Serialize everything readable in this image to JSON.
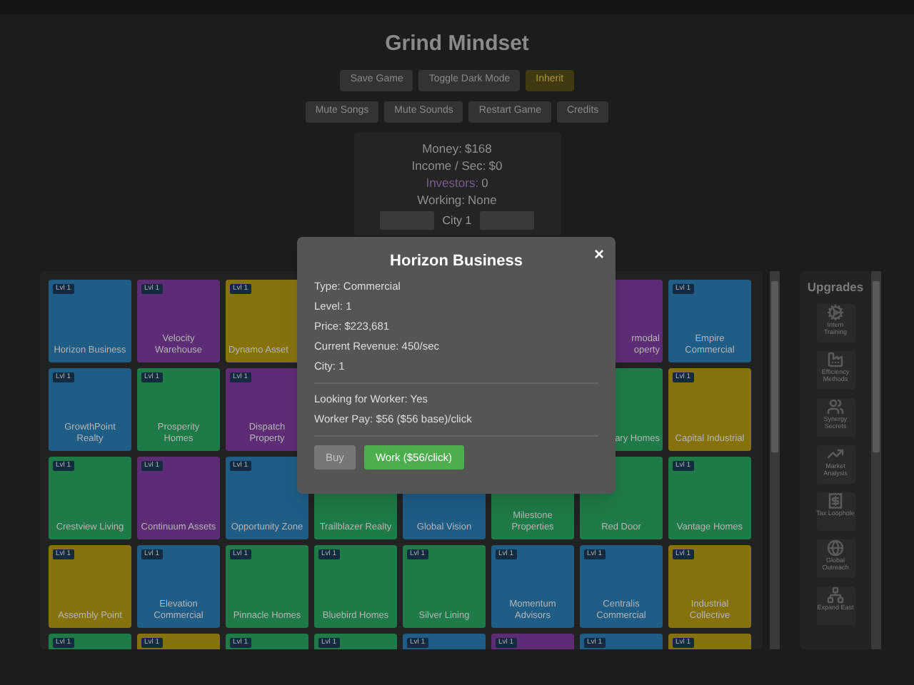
{
  "title": "Grind Mindset",
  "toolbar_rows": [
    [
      {
        "label": "Save Game",
        "kind": "normal"
      },
      {
        "label": "Toggle Dark Mode",
        "kind": "normal"
      },
      {
        "label": "Inherit",
        "kind": "accent"
      }
    ],
    [
      {
        "label": "Mute Songs",
        "kind": "normal"
      },
      {
        "label": "Mute Sounds",
        "kind": "normal"
      },
      {
        "label": "Restart Game",
        "kind": "normal"
      },
      {
        "label": "Credits",
        "kind": "normal"
      }
    ]
  ],
  "stats": [
    {
      "label": "Money:",
      "value": "$168",
      "kind": "plain"
    },
    {
      "label": "Income / Sec:",
      "value": "$0",
      "kind": "plain"
    },
    {
      "label": "Investors:",
      "value": "0",
      "kind": "accent"
    },
    {
      "label": "Working:",
      "value": "None",
      "kind": "plain"
    }
  ],
  "city": {
    "label": "City 1"
  },
  "grid": {
    "rows": [
      [
        {
          "name": "Horizon Business",
          "color": "#1f5c86",
          "badge": "Lvl 1",
          "kind": "whole"
        },
        {
          "name": "Velocity Warehouse",
          "color": "#5e2c74",
          "badge": "Lvl 1",
          "kind": "whole"
        },
        {
          "name": "Dynamo Asset",
          "color": "#86720c",
          "badge": "Lvl 1",
          "kind": "cut-right"
        },
        {
          "kind": "hidden"
        },
        {
          "kind": "hidden"
        },
        {
          "kind": "hidden"
        },
        {
          "name": "rmodal\noperty",
          "color": "#5e2c74",
          "kind": "cut-left"
        },
        {
          "name": "Empire Commercial",
          "color": "#1f5c86",
          "badge": "Lvl 1",
          "kind": "whole"
        }
      ],
      [
        {
          "name": "GrowthPoint\nRealty",
          "color": "#1f5c86",
          "badge": "Lvl 1",
          "kind": "whole"
        },
        {
          "name": "Prosperity\nHomes",
          "color": "#1e7a46",
          "badge": "Lvl 1",
          "kind": "whole"
        },
        {
          "name": "Dispatch\nProperty",
          "color": "#5e2c74",
          "badge": "Lvl 1",
          "kind": "whole"
        },
        {
          "kind": "hidden"
        },
        {
          "kind": "hidden"
        },
        {
          "kind": "hidden"
        },
        {
          "name": "ary Homes",
          "color": "#1e7a46",
          "kind": "cut-left"
        },
        {
          "name": "Capital Industrial",
          "color": "#86720c",
          "badge": "Lvl 1",
          "kind": "whole"
        }
      ],
      [
        {
          "name": "Crestview Living",
          "color": "#1e7a46",
          "badge": "Lvl 1",
          "kind": "whole"
        },
        {
          "name": "Continuum Assets",
          "color": "#5e2c74",
          "badge": "Lvl 1",
          "kind": "whole"
        },
        {
          "name": "Opportunity Zone",
          "color": "#1f5c86",
          "badge": "Lvl 1",
          "kind": "whole"
        },
        {
          "name": "Trailblazer Realty",
          "color": "#1e7a46",
          "kind": "whole"
        },
        {
          "name": "Global Vision",
          "color": "#1f5c86",
          "kind": "whole"
        },
        {
          "name": "Milestone Properties",
          "color": "#1e7a46",
          "kind": "whole"
        },
        {
          "name": "Red Door",
          "color": "#1e7a46",
          "kind": "whole"
        },
        {
          "name": "Vantage Homes",
          "color": "#1e7a46",
          "badge": "Lvl 1",
          "kind": "whole"
        }
      ],
      [
        {
          "name": "Assembly Point",
          "color": "#86720c",
          "badge": "Lvl 1",
          "kind": "whole"
        },
        {
          "name": "Elevation Commercial",
          "color": "#1f5c86",
          "badge": "Lvl 1",
          "kind": "whole"
        },
        {
          "name": "Pinnacle Homes",
          "color": "#1e7a46",
          "badge": "Lvl 1",
          "kind": "whole"
        },
        {
          "name": "Bluebird Homes",
          "color": "#1e7a46",
          "badge": "Lvl 1",
          "kind": "whole"
        },
        {
          "name": "Silver Lining",
          "color": "#1e7a46",
          "badge": "Lvl 1",
          "kind": "whole"
        },
        {
          "name": "Momentum Advisors",
          "color": "#1f5c86",
          "badge": "Lvl 1",
          "kind": "whole"
        },
        {
          "name": "Centralis Commercial",
          "color": "#1f5c86",
          "badge": "Lvl 1",
          "kind": "whole"
        },
        {
          "name": "Industrial Collective",
          "color": "#86720c",
          "badge": "Lvl 1",
          "kind": "whole"
        }
      ],
      [
        {
          "color": "#1e7a46",
          "badge": "Lvl 1",
          "kind": "whole"
        },
        {
          "color": "#86720c",
          "badge": "Lvl 1",
          "kind": "whole"
        },
        {
          "color": "#1e7a46",
          "badge": "Lvl 1",
          "kind": "whole"
        },
        {
          "color": "#1e7a46",
          "badge": "Lvl 1",
          "kind": "whole"
        },
        {
          "color": "#1f5c86",
          "badge": "Lvl 1",
          "kind": "whole"
        },
        {
          "color": "#5e2c74",
          "badge": "Lvl 1",
          "kind": "whole"
        },
        {
          "color": "#1f5c86",
          "badge": "Lvl 1",
          "kind": "whole"
        },
        {
          "color": "#86720c",
          "badge": "Lvl 1",
          "kind": "whole"
        }
      ]
    ]
  },
  "upgrades": {
    "title": "Upgrades",
    "items": [
      {
        "label": "Intern Training",
        "kind": "gear"
      },
      {
        "label": "Efficiency Methods",
        "kind": "factory"
      },
      {
        "label": "Synergy Secrets",
        "kind": "people"
      },
      {
        "label": "Market Analysis",
        "kind": "chart"
      },
      {
        "label": "Tax Loophole",
        "kind": "receipt"
      },
      {
        "label": "Global Outreach",
        "kind": "globe"
      },
      {
        "label": "Expand East",
        "kind": "network"
      }
    ]
  },
  "modal": {
    "title": "Horizon Business",
    "close": "×",
    "details": [
      "Type: Commercial",
      "Level: 1",
      "Price: $223,681",
      "Current Revenue: 450/sec",
      "City: 1"
    ],
    "worker_details": [
      "Looking for Worker: Yes",
      "Worker Pay: $56 ($56 base)/click"
    ],
    "buttons": [
      {
        "label": "Buy",
        "disabled": true
      },
      {
        "label": "Work ($56/click)",
        "disabled": false
      }
    ]
  }
}
